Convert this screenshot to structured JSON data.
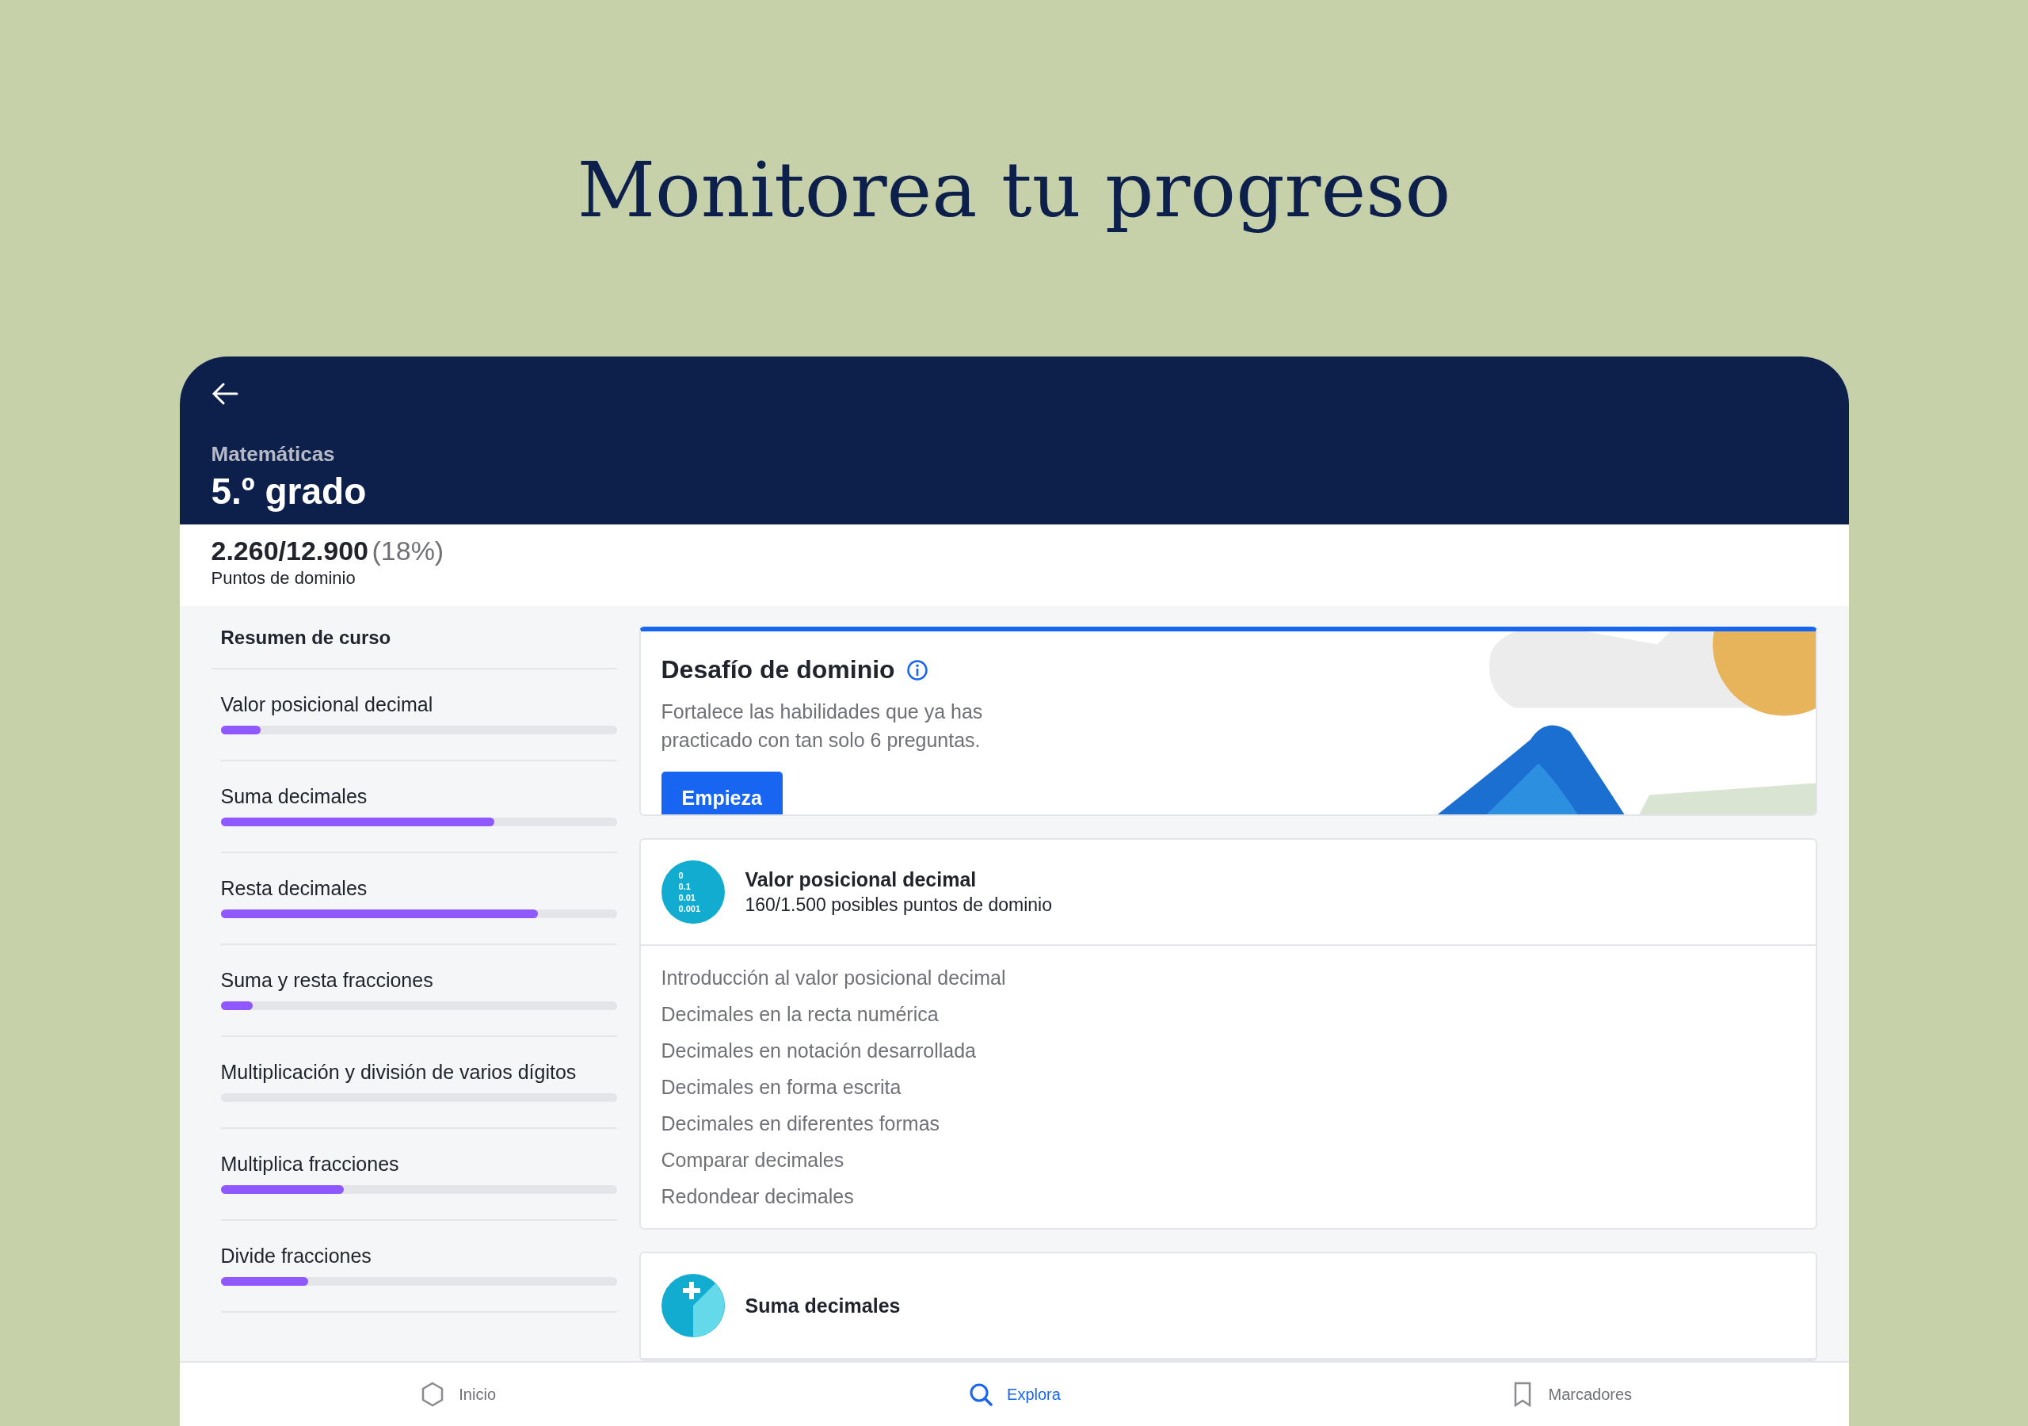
{
  "headline": "Monitorea tu progreso",
  "header": {
    "subject": "Matemáticas",
    "title": "5.º grado"
  },
  "mastery": {
    "points": "2.260/12.900",
    "percent": "(18%)",
    "label": "Puntos de dominio"
  },
  "sidebar": {
    "title": "Resumen de curso",
    "units": [
      {
        "name": "Valor posicional decimal",
        "level": 0.1
      },
      {
        "name": "Suma decimales",
        "level": 0.69
      },
      {
        "name": "Resta decimales",
        "level": 0.8
      },
      {
        "name": "Suma y resta fracciones",
        "level": 0.08
      },
      {
        "name": "Multiplicación y división de varios dígitos",
        "level": 0
      },
      {
        "name": "Multiplica fracciones",
        "level": 0.31
      },
      {
        "name": "Divide fracciones",
        "level": 0.22
      }
    ]
  },
  "challenge": {
    "title": "Desafío de dominio",
    "description": "Fortalece las habilidades que ya has practicado con tan solo 6 preguntas.",
    "button": "Empieza"
  },
  "units": [
    {
      "kind": "digits",
      "title": "Valor posicional decimal",
      "subtitle": "160/1.500 posibles puntos de dominio",
      "icon_lines": [
        "0",
        "0.1",
        "0.01",
        "0.001"
      ],
      "lessons": [
        "Introducción al valor posicional decimal",
        "Decimales en la recta numérica",
        "Decimales en notación desarrollada",
        "Decimales en forma escrita",
        "Decimales en diferentes formas",
        "Comparar decimales",
        "Redondear decimales"
      ]
    },
    {
      "kind": "plus",
      "title": "Suma decimales"
    }
  ],
  "nav": [
    {
      "label": "Inicio",
      "kind": "home",
      "selected": false
    },
    {
      "label": "Explora",
      "kind": "search",
      "selected": true
    },
    {
      "label": "Marcadores",
      "kind": "bookmark",
      "selected": false
    }
  ]
}
